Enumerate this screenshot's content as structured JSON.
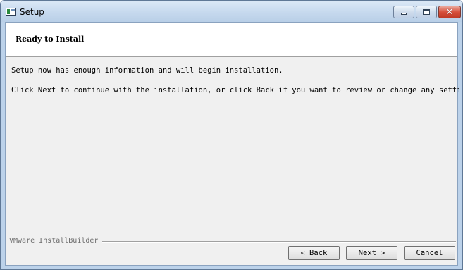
{
  "window": {
    "title": "Setup",
    "close_glyph": "✕"
  },
  "header": {
    "title": "Ready to Install"
  },
  "body": {
    "line1": "Setup now has enough information and will begin installation.",
    "line2": "Click Next to continue with the installation, or click Back if you want to review or change any settings."
  },
  "footer": {
    "brand": "VMware InstallBuilder",
    "back": {
      "arrow": "<",
      "label": "Back"
    },
    "next": {
      "label": "Next",
      "arrow": ">"
    },
    "cancel": {
      "label": "Cancel"
    }
  },
  "icons": [
    "app-icon",
    "minimize-icon",
    "maximize-icon",
    "close-icon"
  ],
  "colors": {
    "titlebar": "#c6d9ee",
    "close_button": "#d7503c",
    "client_bg": "#f0f0f0"
  }
}
